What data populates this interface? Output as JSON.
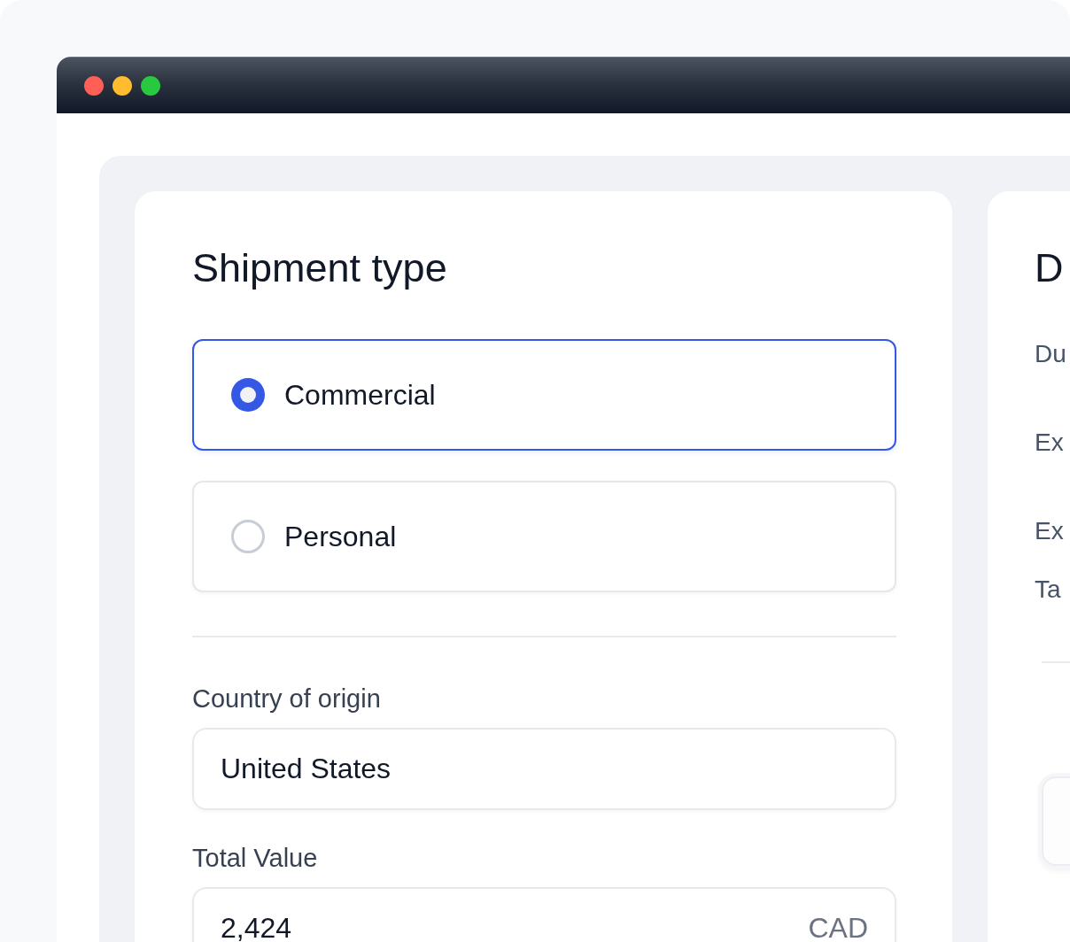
{
  "shipment_card": {
    "title": "Shipment type",
    "options": [
      {
        "label": "Commercial",
        "selected": true
      },
      {
        "label": "Personal",
        "selected": false
      }
    ],
    "fields": [
      {
        "label": "Country of origin",
        "value": "United States"
      },
      {
        "label": "Total Value",
        "value": "2,424",
        "suffix": "CAD"
      }
    ]
  },
  "details_card": {
    "title": "D",
    "rows": [
      {
        "label": "Du"
      },
      {
        "label": "Ex"
      },
      {
        "label": "Ex"
      },
      {
        "label": "Ta"
      }
    ]
  }
}
